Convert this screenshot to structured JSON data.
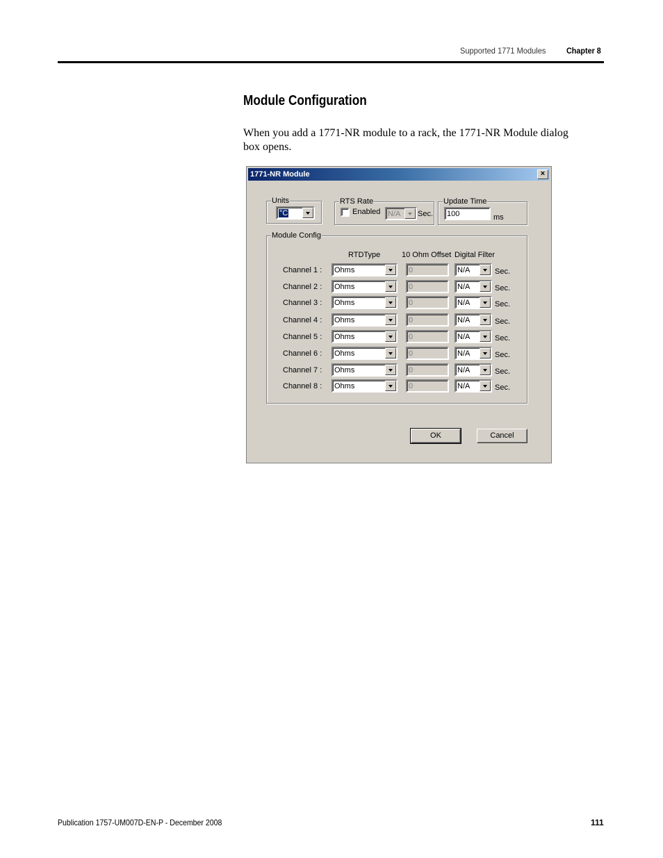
{
  "header": {
    "section": "Supported 1771 Modules",
    "chapter": "Chapter 8"
  },
  "section_title": "Module Configuration",
  "body_text": "When you add a 1771-NR module to a rack, the 1771-NR Module dialog box opens.",
  "dialog": {
    "title": "1771-NR Module",
    "close_label": "×",
    "units": {
      "group_label": "Units",
      "value": "°C"
    },
    "rts_rate": {
      "group_label": "RTS Rate",
      "enabled_label": "Enabled",
      "enabled_checked": false,
      "value": "N/A",
      "unit": "Sec."
    },
    "update_time": {
      "group_label": "Update Time",
      "value": "100",
      "unit": "ms"
    },
    "module_config": {
      "group_label": "Module Config",
      "columns": {
        "rtd_type": "RTDType",
        "offset": "10 Ohm Offset",
        "digital_filter": "Digital Filter"
      },
      "filter_unit": "Sec.",
      "channels": [
        {
          "label": "Channel 1 :",
          "rtd_type": "Ohms",
          "offset": "0",
          "filter": "N/A"
        },
        {
          "label": "Channel 2 :",
          "rtd_type": "Ohms",
          "offset": "0",
          "filter": "N/A"
        },
        {
          "label": "Channel 3 :",
          "rtd_type": "Ohms",
          "offset": "0",
          "filter": "N/A"
        },
        {
          "label": "Channel 4 :",
          "rtd_type": "Ohms",
          "offset": "0",
          "filter": "N/A"
        },
        {
          "label": "Channel 5 :",
          "rtd_type": "Ohms",
          "offset": "0",
          "filter": "N/A"
        },
        {
          "label": "Channel 6 :",
          "rtd_type": "Ohms",
          "offset": "0",
          "filter": "N/A"
        },
        {
          "label": "Channel 7 :",
          "rtd_type": "Ohms",
          "offset": "0",
          "filter": "N/A"
        },
        {
          "label": "Channel 8 :",
          "rtd_type": "Ohms",
          "offset": "0",
          "filter": "N/A"
        }
      ]
    },
    "ok_label": "OK",
    "cancel_label": "Cancel"
  },
  "footer": {
    "publication": "Publication 1757-UM007D-EN-P - December 2008",
    "page_number": "111"
  }
}
